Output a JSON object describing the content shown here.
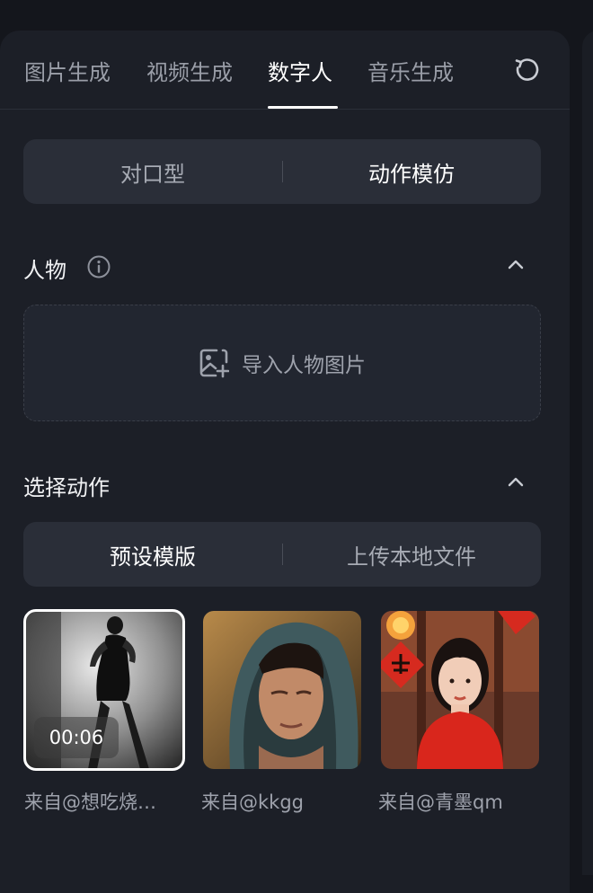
{
  "tabs": [
    {
      "label": "图片生成",
      "active": false
    },
    {
      "label": "视频生成",
      "active": false
    },
    {
      "label": "数字人",
      "active": true
    },
    {
      "label": "音乐生成",
      "active": false
    }
  ],
  "mode_switch": {
    "options": [
      "对口型",
      "动作模仿"
    ],
    "selected": "动作模仿"
  },
  "character_section": {
    "title": "人物",
    "upload_label": "导入人物图片"
  },
  "action_section": {
    "title": "选择动作",
    "source_switch": {
      "options": [
        "预设模版",
        "上传本地文件"
      ],
      "selected": "预设模版"
    },
    "templates": [
      {
        "caption": "来自@想吃烧…",
        "duration": "00:06",
        "selected": true
      },
      {
        "caption": "来自@kkgg",
        "selected": false
      },
      {
        "caption": "来自@青墨qm",
        "selected": false
      }
    ]
  },
  "icons": {
    "refresh": "refresh-icon",
    "info": "info-icon",
    "collapse": "chevron-up-icon",
    "upload": "image-add-icon"
  },
  "colors": {
    "background": "#14161c",
    "panel": "#1c1f27",
    "segment": "#2a2e38",
    "active_text": "#ffffff",
    "muted_text": "#9ea2ac"
  }
}
